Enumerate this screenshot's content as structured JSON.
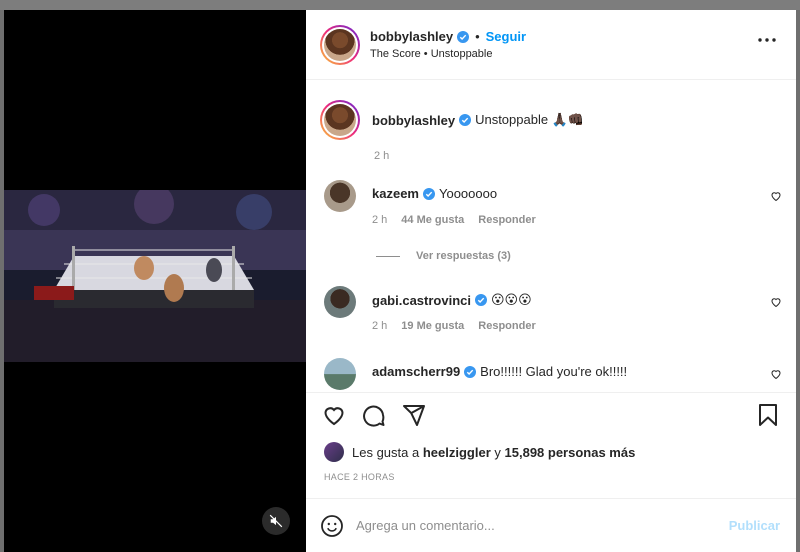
{
  "post": {
    "author": "bobbylashley",
    "follow_label": "Seguir",
    "audio_line": "The Score • Unstoppable",
    "caption_text": "Unstoppable 🙏🏿👊🏿",
    "caption_time": "2 h"
  },
  "comments": [
    {
      "user": "kazeem",
      "text": "Yooooooo",
      "time": "2 h",
      "likes": "44 Me gusta",
      "reply": "Responder",
      "view_replies": "Ver respuestas (3)"
    },
    {
      "user": "gabi.castrovinci",
      "text": "😮😮😮",
      "time": "2 h",
      "likes": "19 Me gusta",
      "reply": "Responder"
    },
    {
      "user": "adamscherr99",
      "text": "Bro!!!!!! Glad you're ok!!!!!"
    }
  ],
  "likes_line": {
    "prefix": "Les gusta a",
    "user": "heelziggler",
    "connector": "y",
    "others": "15,898 personas más"
  },
  "timestamp": "HACE 2 HORAS",
  "composer": {
    "placeholder": "Agrega un comentario...",
    "publish_label": "Publicar"
  },
  "icons": {
    "more": "more-options-icon",
    "like": "heart-icon",
    "comment": "comment-icon",
    "share": "share-icon",
    "save": "bookmark-icon",
    "emoji": "emoji-icon",
    "mute": "muted-speaker-icon",
    "verified": "verified-badge-icon"
  },
  "colors": {
    "accent": "#0095f6",
    "publish_disabled": "#b2dffc",
    "verified": "#3897f0"
  }
}
